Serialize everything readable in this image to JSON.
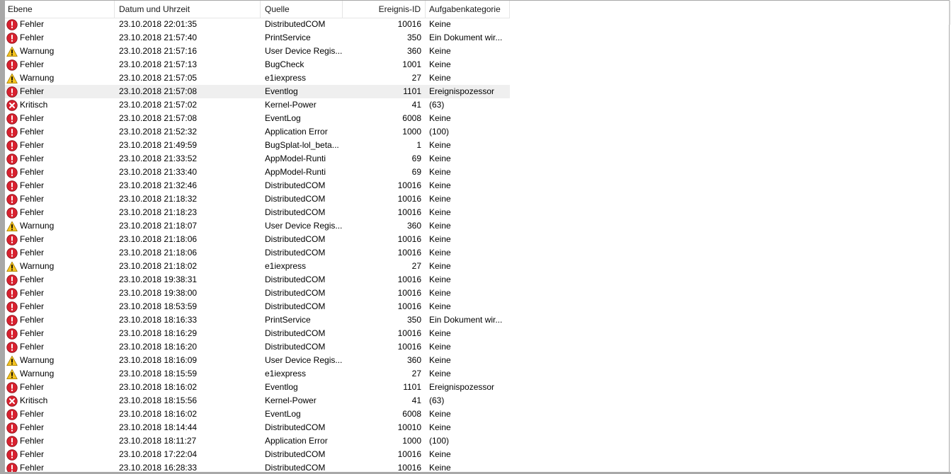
{
  "columns": {
    "level": "Ebene",
    "datetime": "Datum und Uhrzeit",
    "source": "Quelle",
    "event_id": "Ereignis-ID",
    "category": "Aufgabenkategorie"
  },
  "selected_row_index": 5,
  "level_icons": {
    "Fehler": "error-icon",
    "Warnung": "warning-icon",
    "Kritisch": "critical-icon"
  },
  "colors": {
    "error": "#d8212f",
    "warning": "#f6c421",
    "selected_row": "#efefef"
  },
  "rows": [
    {
      "level": "Fehler",
      "datetime": "23.10.2018 22:01:35",
      "source": "DistributedCOM",
      "event_id": "10016",
      "category": "Keine"
    },
    {
      "level": "Fehler",
      "datetime": "23.10.2018 21:57:40",
      "source": "PrintService",
      "event_id": "350",
      "category": "Ein Dokument wir..."
    },
    {
      "level": "Warnung",
      "datetime": "23.10.2018 21:57:16",
      "source": "User Device Regis...",
      "event_id": "360",
      "category": "Keine"
    },
    {
      "level": "Fehler",
      "datetime": "23.10.2018 21:57:13",
      "source": "BugCheck",
      "event_id": "1001",
      "category": "Keine"
    },
    {
      "level": "Warnung",
      "datetime": "23.10.2018 21:57:05",
      "source": "e1iexpress",
      "event_id": "27",
      "category": "Keine"
    },
    {
      "level": "Fehler",
      "datetime": "23.10.2018 21:57:08",
      "source": "Eventlog",
      "event_id": "1101",
      "category": "Ereignispozessor"
    },
    {
      "level": "Kritisch",
      "datetime": "23.10.2018 21:57:02",
      "source": "Kernel-Power",
      "event_id": "41",
      "category": "(63)"
    },
    {
      "level": "Fehler",
      "datetime": "23.10.2018 21:57:08",
      "source": "EventLog",
      "event_id": "6008",
      "category": "Keine"
    },
    {
      "level": "Fehler",
      "datetime": "23.10.2018 21:52:32",
      "source": "Application Error",
      "event_id": "1000",
      "category": "(100)"
    },
    {
      "level": "Fehler",
      "datetime": "23.10.2018 21:49:59",
      "source": "BugSplat-lol_beta...",
      "event_id": "1",
      "category": "Keine"
    },
    {
      "level": "Fehler",
      "datetime": "23.10.2018 21:33:52",
      "source": "AppModel-Runti",
      "event_id": "69",
      "category": "Keine"
    },
    {
      "level": "Fehler",
      "datetime": "23.10.2018 21:33:40",
      "source": "AppModel-Runti",
      "event_id": "69",
      "category": "Keine"
    },
    {
      "level": "Fehler",
      "datetime": "23.10.2018 21:32:46",
      "source": "DistributedCOM",
      "event_id": "10016",
      "category": "Keine"
    },
    {
      "level": "Fehler",
      "datetime": "23.10.2018 21:18:32",
      "source": "DistributedCOM",
      "event_id": "10016",
      "category": "Keine"
    },
    {
      "level": "Fehler",
      "datetime": "23.10.2018 21:18:23",
      "source": "DistributedCOM",
      "event_id": "10016",
      "category": "Keine"
    },
    {
      "level": "Warnung",
      "datetime": "23.10.2018 21:18:07",
      "source": "User Device Regis...",
      "event_id": "360",
      "category": "Keine"
    },
    {
      "level": "Fehler",
      "datetime": "23.10.2018 21:18:06",
      "source": "DistributedCOM",
      "event_id": "10016",
      "category": "Keine"
    },
    {
      "level": "Fehler",
      "datetime": "23.10.2018 21:18:06",
      "source": "DistributedCOM",
      "event_id": "10016",
      "category": "Keine"
    },
    {
      "level": "Warnung",
      "datetime": "23.10.2018 21:18:02",
      "source": "e1iexpress",
      "event_id": "27",
      "category": "Keine"
    },
    {
      "level": "Fehler",
      "datetime": "23.10.2018 19:38:31",
      "source": "DistributedCOM",
      "event_id": "10016",
      "category": "Keine"
    },
    {
      "level": "Fehler",
      "datetime": "23.10.2018 19:38:00",
      "source": "DistributedCOM",
      "event_id": "10016",
      "category": "Keine"
    },
    {
      "level": "Fehler",
      "datetime": "23.10.2018 18:53:59",
      "source": "DistributedCOM",
      "event_id": "10016",
      "category": "Keine"
    },
    {
      "level": "Fehler",
      "datetime": "23.10.2018 18:16:33",
      "source": "PrintService",
      "event_id": "350",
      "category": "Ein Dokument wir..."
    },
    {
      "level": "Fehler",
      "datetime": "23.10.2018 18:16:29",
      "source": "DistributedCOM",
      "event_id": "10016",
      "category": "Keine"
    },
    {
      "level": "Fehler",
      "datetime": "23.10.2018 18:16:20",
      "source": "DistributedCOM",
      "event_id": "10016",
      "category": "Keine"
    },
    {
      "level": "Warnung",
      "datetime": "23.10.2018 18:16:09",
      "source": "User Device Regis...",
      "event_id": "360",
      "category": "Keine"
    },
    {
      "level": "Warnung",
      "datetime": "23.10.2018 18:15:59",
      "source": "e1iexpress",
      "event_id": "27",
      "category": "Keine"
    },
    {
      "level": "Fehler",
      "datetime": "23.10.2018 18:16:02",
      "source": "Eventlog",
      "event_id": "1101",
      "category": "Ereignispozessor"
    },
    {
      "level": "Kritisch",
      "datetime": "23.10.2018 18:15:56",
      "source": "Kernel-Power",
      "event_id": "41",
      "category": "(63)"
    },
    {
      "level": "Fehler",
      "datetime": "23.10.2018 18:16:02",
      "source": "EventLog",
      "event_id": "6008",
      "category": "Keine"
    },
    {
      "level": "Fehler",
      "datetime": "23.10.2018 18:14:44",
      "source": "DistributedCOM",
      "event_id": "10010",
      "category": "Keine"
    },
    {
      "level": "Fehler",
      "datetime": "23.10.2018 18:11:27",
      "source": "Application Error",
      "event_id": "1000",
      "category": "(100)"
    },
    {
      "level": "Fehler",
      "datetime": "23.10.2018 17:22:04",
      "source": "DistributedCOM",
      "event_id": "10016",
      "category": "Keine"
    },
    {
      "level": "Fehler",
      "datetime": "23.10.2018 16:28:33",
      "source": "DistributedCOM",
      "event_id": "10016",
      "category": "Keine"
    }
  ]
}
